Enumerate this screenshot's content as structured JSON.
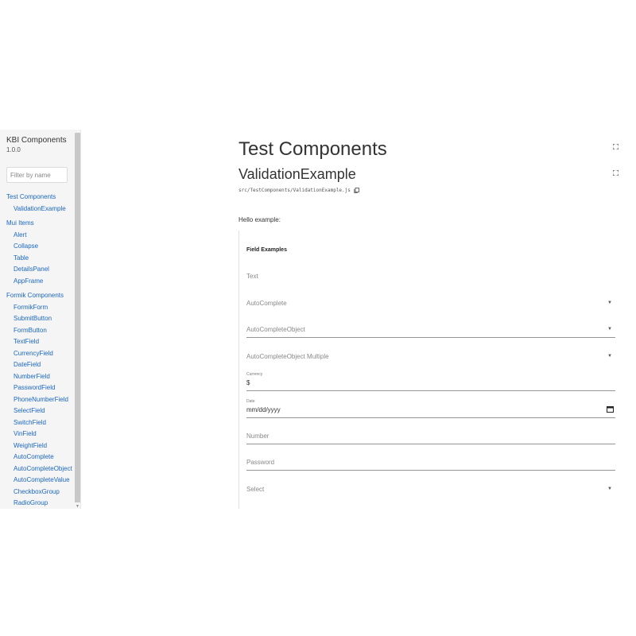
{
  "sidebar": {
    "title": "KBI Components",
    "version": "1.0.0",
    "filter_placeholder": "Filter by name",
    "groups": [
      {
        "label": "Test Components",
        "items": [
          "ValidationExample"
        ]
      },
      {
        "label": "Mui Items",
        "items": [
          "Alert",
          "Collapse",
          "Table",
          "DetailsPanel",
          "AppFrame"
        ]
      },
      {
        "label": "Formik Components",
        "items": [
          "FormikForm",
          "SubmitButton",
          "FormButton",
          "TextField",
          "CurrencyField",
          "DateField",
          "NumberField",
          "PasswordField",
          "PhoneNumberField",
          "SelectField",
          "SwitchField",
          "VinField",
          "WeightField",
          "AutoComplete",
          "AutoCompleteObject",
          "AutoCompleteValue",
          "CheckboxGroup",
          "RadioGroup"
        ]
      }
    ]
  },
  "main": {
    "page_title": "Test Components",
    "section_title": "ValidationExample",
    "path": "src/TestComponents/ValidationExample.js",
    "hello_label": "Hello example:",
    "preview": {
      "heading": "Field Examples",
      "fields": {
        "text": {
          "label": "Text"
        },
        "autocomplete": {
          "label": "AutoComplete"
        },
        "autocomplete_object": {
          "label": "AutoCompleteObject"
        },
        "autocomplete_object_multiple": {
          "label": "AutoCompleteObject Multiple"
        },
        "currency": {
          "label": "Currency",
          "value": "$"
        },
        "date": {
          "label": "Date",
          "value": "mm/dd/yyyy"
        },
        "number": {
          "label": "Number"
        },
        "password": {
          "label": "Password"
        },
        "select": {
          "label": "Select"
        }
      }
    }
  },
  "icons": {
    "expand": "expand-icon",
    "copy": "copy-icon",
    "calendar": "calendar-icon",
    "caret": "caret-down-icon"
  },
  "colors": {
    "link": "#1a67c5",
    "sidebar_bg": "#f5f5f5"
  }
}
